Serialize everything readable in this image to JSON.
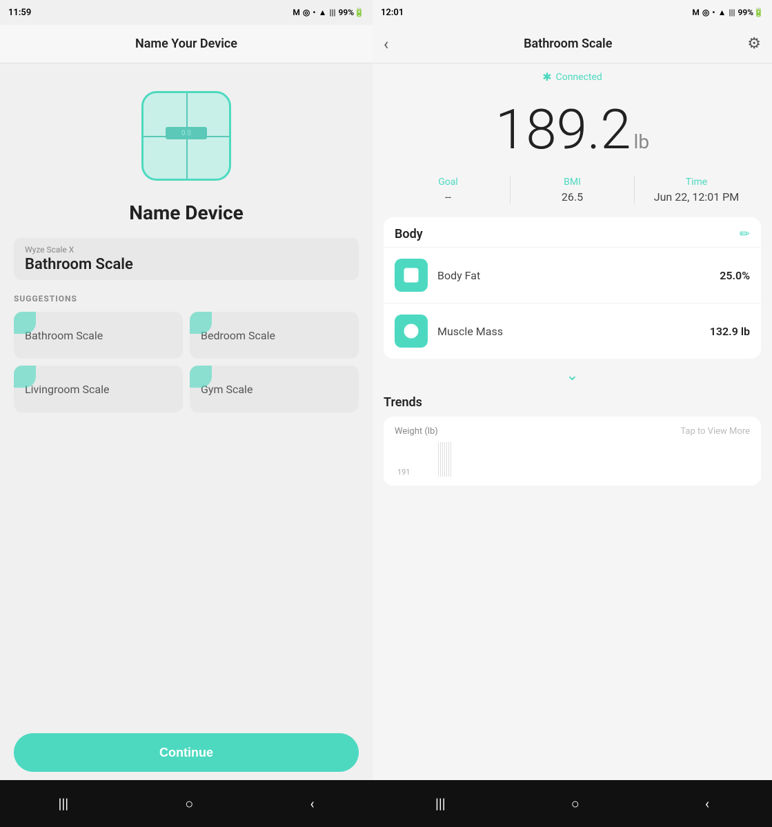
{
  "left": {
    "status_time": "11:59",
    "status_icons": "M ◎ • ▲ |||  99%",
    "header_title": "Name Your Device",
    "name_device_label": "Name Device",
    "device_subtitle": "Wyze Scale X",
    "device_name": "Bathroom Scale",
    "suggestions_label": "SUGGESTIONS",
    "suggestions": [
      "Bathroom Scale",
      "Bedroom Scale",
      "Livingroom Scale",
      "Gym Scale"
    ],
    "continue_label": "Continue",
    "nav": [
      "|||",
      "○",
      "‹"
    ]
  },
  "right": {
    "status_time": "12:01",
    "status_icons": "M ◎ • ▲ ||| 99%",
    "header_title": "Bathroom Scale",
    "bluetooth_label": "Connected",
    "weight_value": "189.2",
    "weight_unit": "lb",
    "stats": [
      {
        "label": "Goal",
        "value": "--"
      },
      {
        "label": "BMI",
        "value": "26.5"
      },
      {
        "label": "Time",
        "value": "Jun 22, 12:01 PM"
      }
    ],
    "body_section_title": "Body",
    "metrics": [
      {
        "name": "Body Fat",
        "value": "25.0%"
      },
      {
        "name": "Muscle Mass",
        "value": "132.9 lb"
      }
    ],
    "trends_title": "Trends",
    "chart_label": "Weight (lb)",
    "chart_tap": "Tap to View More",
    "chart_y_value": "191",
    "nav": [
      "|||",
      "○",
      "‹"
    ]
  },
  "colors": {
    "teal": "#4dd9c0",
    "dark": "#222222",
    "gray": "#888888"
  }
}
